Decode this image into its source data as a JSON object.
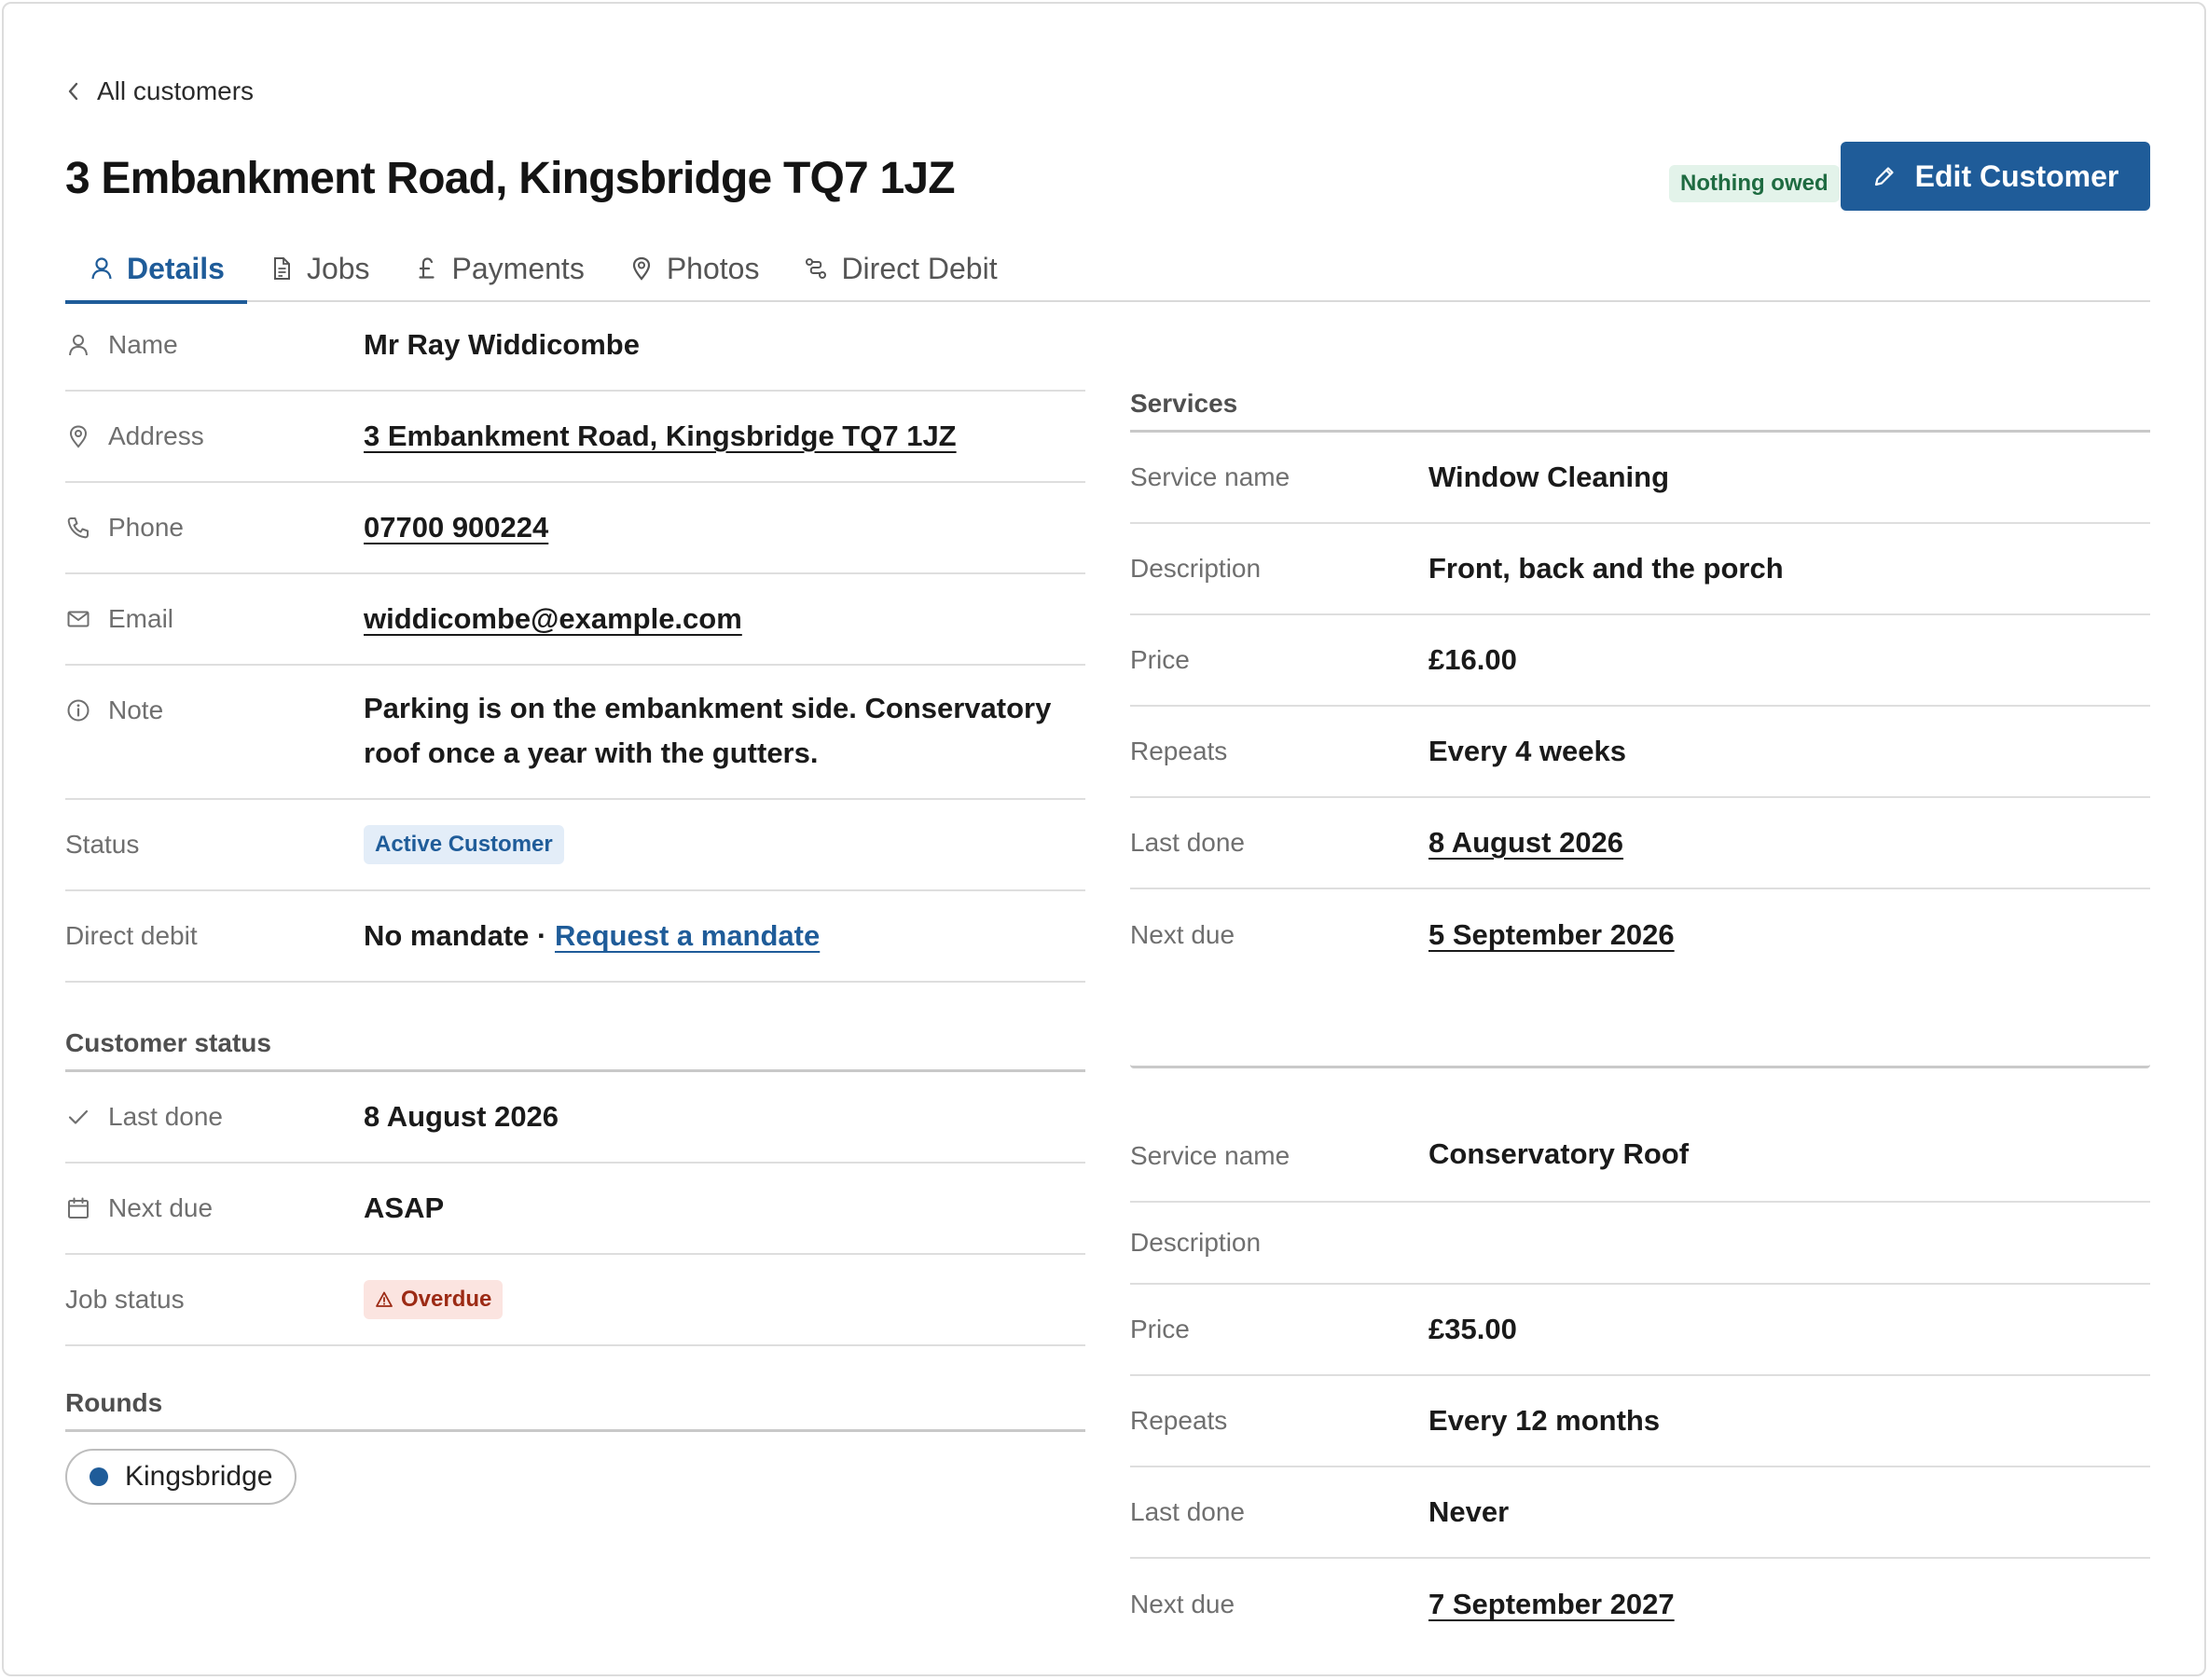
{
  "back_link": "All customers",
  "page_title": "3 Embankment Road, Kingsbridge TQ7 1JZ",
  "owed_badge": "Nothing owed",
  "edit_button": "Edit Customer",
  "tabs": [
    {
      "label": "Details",
      "icon": "person-icon",
      "active": true
    },
    {
      "label": "Jobs",
      "icon": "document-icon"
    },
    {
      "label": "Payments",
      "icon": "pound-icon"
    },
    {
      "label": "Photos",
      "icon": "location-pin-icon"
    },
    {
      "label": "Direct Debit",
      "icon": "route-icon"
    }
  ],
  "details": {
    "name_label": "Name",
    "name_value": "Mr Ray Widdicombe",
    "address_label": "Address",
    "address_value": "3 Embankment Road, Kingsbridge TQ7 1JZ",
    "phone_label": "Phone",
    "phone_value": "07700 900224",
    "email_label": "Email",
    "email_value": "widdicombe@example.com",
    "note_label": "Note",
    "note_value": "Parking is on the embankment side. Conservatory roof once a year with the gutters.",
    "status_label": "Status",
    "status_value": "Active Customer",
    "dd_label": "Direct debit",
    "dd_value": "No mandate",
    "dd_sep": " · ",
    "dd_link": "Request a mandate"
  },
  "customer_status": {
    "heading": "Customer status",
    "last_done_label": "Last done",
    "last_done_value": "8 August 2026",
    "next_due_label": "Next due",
    "next_due_value": "ASAP",
    "job_status_label": "Job status",
    "job_status_value": "Overdue"
  },
  "rounds": {
    "heading": "Rounds",
    "items": [
      {
        "label": "Kingsbridge",
        "color": "#1f5c99"
      }
    ]
  },
  "services": {
    "heading": "Services",
    "items": [
      {
        "service_name_label": "Service name",
        "service_name": "Window Cleaning",
        "description_label": "Description",
        "description": "Front, back and the porch",
        "price_label": "Price",
        "price": "£16.00",
        "repeats_label": "Repeats",
        "repeats": "Every 4 weeks",
        "last_done_label": "Last done",
        "last_done": "8 August 2026",
        "next_due_label": "Next due",
        "next_due": "5 September 2026"
      },
      {
        "service_name_label": "Service name",
        "service_name": "Conservatory Roof",
        "description_label": "Description",
        "description": "",
        "price_label": "Price",
        "price": "£35.00",
        "repeats_label": "Repeats",
        "repeats": "Every 12 months",
        "last_done_label": "Last done",
        "last_done": "Never",
        "next_due_label": "Next due",
        "next_due": "7 September 2027"
      }
    ]
  },
  "colors": {
    "accent": "#1f5c99",
    "positive_bg": "#e3f3ea",
    "danger_bg": "#fbe4e0"
  }
}
